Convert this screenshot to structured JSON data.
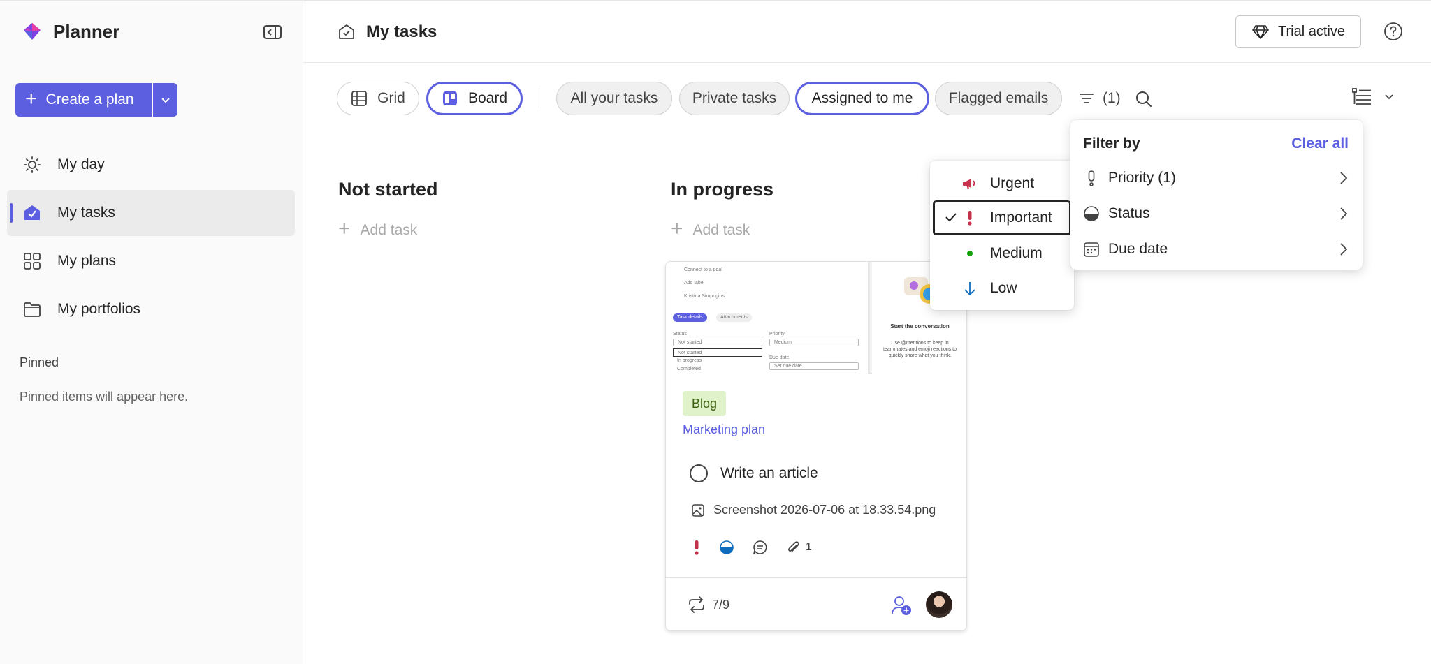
{
  "app": {
    "name": "Planner"
  },
  "sidebar": {
    "create_label": "Create a plan",
    "items": [
      {
        "label": "My day",
        "icon": "sun-icon"
      },
      {
        "label": "My tasks",
        "icon": "tasks-icon",
        "active": true
      },
      {
        "label": "My plans",
        "icon": "grid-icon"
      },
      {
        "label": "My portfolios",
        "icon": "folder-icon"
      }
    ],
    "pinned_title": "Pinned",
    "pinned_empty": "Pinned items will appear here."
  },
  "header": {
    "title": "My tasks",
    "trial_label": "Trial active"
  },
  "toolbar": {
    "views": [
      {
        "label": "Grid",
        "selected": false
      },
      {
        "label": "Board",
        "selected": true
      }
    ],
    "filters": [
      {
        "label": "All your tasks",
        "selected": false
      },
      {
        "label": "Private tasks",
        "selected": false
      },
      {
        "label": "Assigned to me",
        "selected": true
      },
      {
        "label": "Flagged emails",
        "selected": false
      }
    ],
    "filter_count": "(1)"
  },
  "board": {
    "columns": [
      {
        "title": "Not started",
        "add_label": "Add task"
      },
      {
        "title": "In progress",
        "add_label": "Add task"
      }
    ]
  },
  "card": {
    "tag": "Blog",
    "plan": "Marketing plan",
    "title": "Write an article",
    "attachment": "Screenshot 2026-07-06 at 18.33.54.png",
    "attachment_count": "1",
    "checklist": "7/9",
    "preview": {
      "connect": "Connect to a goal",
      "add_label": "Add label",
      "person": "Kristina Simpugins",
      "tab_details": "Task details",
      "tab_attach": "Attachments",
      "status_label": "Status",
      "priority_label": "Priority",
      "status_value": "Not started",
      "priority_value": "Medium",
      "opt_not_started": "Not started",
      "opt_in_progress": "In progress",
      "opt_completed": "Completed",
      "due_label": "Due date",
      "due_placeholder": "Set due date",
      "convo_title": "Start the conversation",
      "convo_text": "Use @mentions to keep in teammates and emoji reactions to quickly share what you think."
    }
  },
  "priority_menu": {
    "items": [
      {
        "label": "Urgent",
        "icon": "megaphone-icon",
        "color": "#c4314b",
        "selected": false
      },
      {
        "label": "Important",
        "icon": "exclamation-icon",
        "color": "#c4314b",
        "selected": true
      },
      {
        "label": "Medium",
        "icon": "dot-icon",
        "color": "#13a10e",
        "selected": false
      },
      {
        "label": "Low",
        "icon": "arrow-down-icon",
        "color": "#0f6cbd",
        "selected": false
      }
    ]
  },
  "filter_panel": {
    "title": "Filter by",
    "clear_label": "Clear all",
    "rows": [
      {
        "label": "Priority (1)",
        "icon": "priority-icon"
      },
      {
        "label": "Status",
        "icon": "status-icon"
      },
      {
        "label": "Due date",
        "icon": "calendar-icon"
      }
    ]
  },
  "colors": {
    "accent": "#5b5fe0",
    "urgent": "#c4314b",
    "medium": "#13a10e",
    "low": "#0f6cbd",
    "tag_bg": "#dff2c9"
  }
}
